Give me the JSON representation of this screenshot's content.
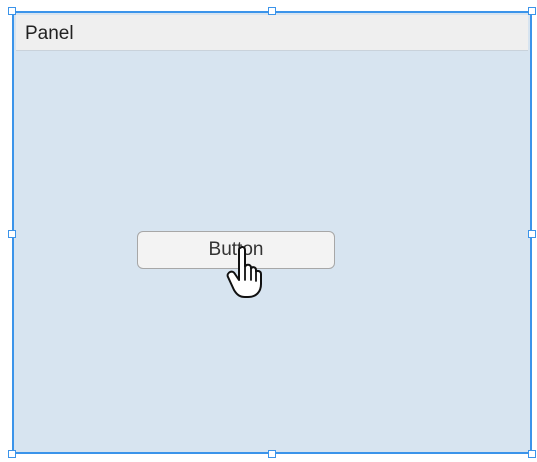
{
  "panel": {
    "title": "Panel"
  },
  "button": {
    "label": "Button"
  },
  "selection": {
    "handles": [
      "top-left",
      "top-center",
      "top-right",
      "middle-left",
      "middle-right",
      "bottom-left",
      "bottom-center",
      "bottom-right"
    ]
  },
  "cursor": {
    "icon": "hand-pointer-icon"
  },
  "colors": {
    "selection": "#3b94ea",
    "panel_body": "#d7e4f0",
    "panel_header": "#efefef",
    "button_fill": "#f3f3f3",
    "button_border": "#a7a7a7"
  }
}
